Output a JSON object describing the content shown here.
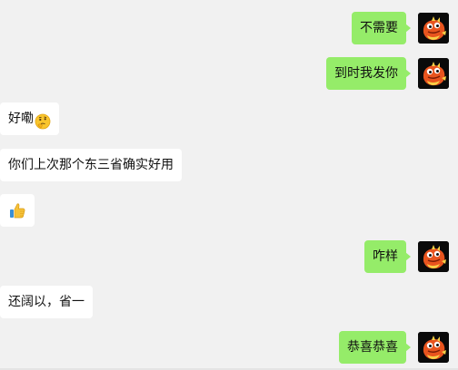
{
  "messages": [
    {
      "side": "me",
      "text": "不需要"
    },
    {
      "side": "me",
      "text": "到时我发你"
    },
    {
      "side": "other",
      "text": "好嘞",
      "emoji": "thinking-face-emoji"
    },
    {
      "side": "other",
      "text": "你们上次那个东三省确实好用"
    },
    {
      "side": "other",
      "text": "",
      "emoji": "thumbs-up-emoji"
    },
    {
      "side": "me",
      "text": "咋样"
    },
    {
      "side": "other",
      "text": "还阔以，省一"
    },
    {
      "side": "me",
      "text": "恭喜恭喜"
    }
  ],
  "avatar": {
    "icon": "dragon-mascot-avatar",
    "bg": "#0a0a0a"
  },
  "colors": {
    "me_bubble": "#95ec69",
    "other_bubble": "#ffffff",
    "background": "#f1f1f1"
  }
}
